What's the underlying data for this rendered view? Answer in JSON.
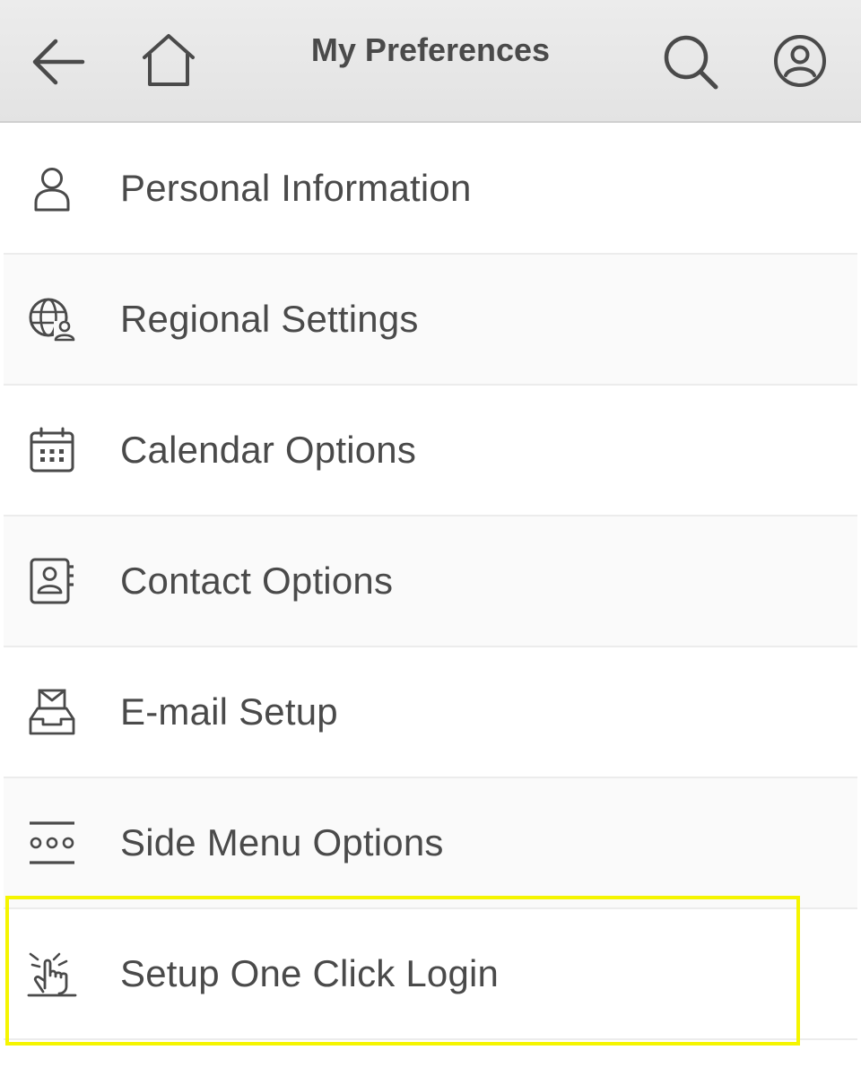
{
  "header": {
    "title": "My Preferences",
    "back_icon": "arrow-left-icon",
    "home_icon": "home-icon",
    "search_icon": "search-icon",
    "profile_icon": "user-circle-icon"
  },
  "menu": {
    "items": [
      {
        "label": "Personal Information",
        "icon": "person-icon"
      },
      {
        "label": "Regional Settings",
        "icon": "globe-user-icon"
      },
      {
        "label": "Calendar Options",
        "icon": "calendar-icon"
      },
      {
        "label": "Contact Options",
        "icon": "contact-book-icon"
      },
      {
        "label": "E-mail Setup",
        "icon": "mail-inbox-icon"
      },
      {
        "label": "Side Menu Options",
        "icon": "menu-dots-icon"
      },
      {
        "label": "Setup One Click Login",
        "icon": "tap-hand-icon"
      }
    ]
  },
  "colors": {
    "highlight": "#f5f500",
    "text": "#4a4a4a",
    "header_bg": "#e8e8e8"
  }
}
